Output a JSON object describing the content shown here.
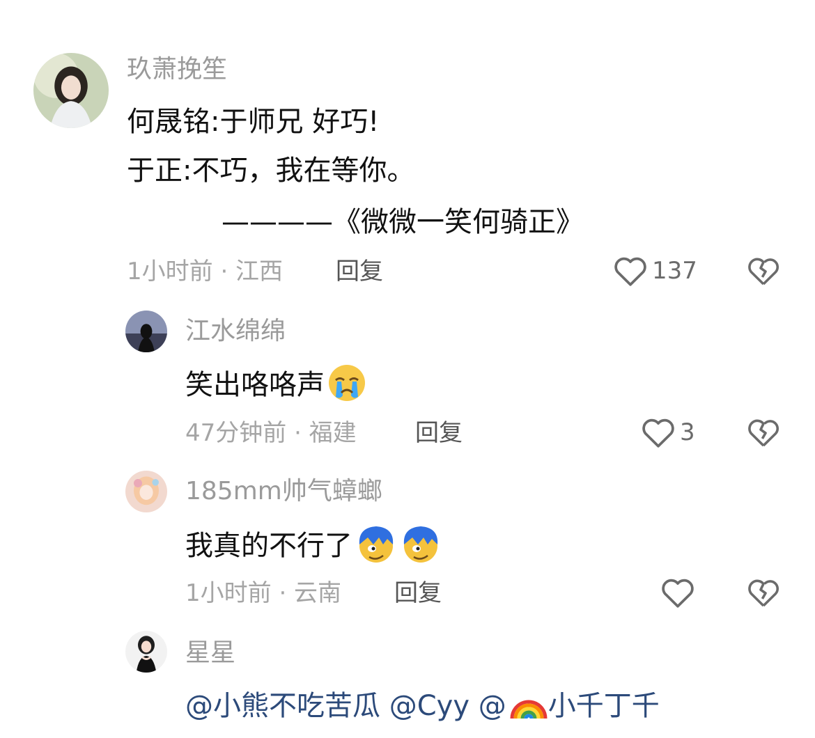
{
  "comments": [
    {
      "username": "玖萧挽笙",
      "lines": [
        "何晟铭:于师兄  好巧!",
        "于正:不巧，我在等你。",
        "————《微微一笑何骑正》"
      ],
      "time_location": "1小时前 · 江西",
      "reply_label": "回复",
      "likes": "137"
    },
    {
      "username": "江水绵绵",
      "text": "笑出咯咯声",
      "emoji": "crying-face",
      "time_location": "47分钟前 · 福建",
      "reply_label": "回复",
      "likes": "3"
    },
    {
      "username": "185mm帅气蟑螂",
      "text": "我真的不行了",
      "emoji": "blue-hair-face",
      "time_location": "1小时前 · 云南",
      "reply_label": "回复",
      "likes": ""
    },
    {
      "username": "星星",
      "mentions": [
        "@小熊不吃苦瓜",
        "@Cyy",
        "@",
        "小千丁千"
      ],
      "emoji": "rainbow"
    }
  ],
  "colors": {
    "username": "#9a9a9a",
    "meta": "#a5a5a5",
    "icon": "#6b6b6b"
  }
}
